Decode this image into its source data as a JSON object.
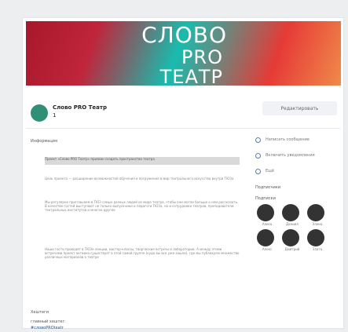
{
  "banner": {
    "line1": "СЛОВО",
    "line2": "PRO",
    "line3": "ТЕАТР"
  },
  "profile": {
    "name": "Слово PRO Театр",
    "status": "1",
    "edit_button": "Редактировать"
  },
  "info": {
    "title": "Информация",
    "description": "Проект «Слово PRO Театр» призван создать пространство театра",
    "lines": [
      "Цель проекта — расширение возможностей обучения и погружения в мир театрального искусства внутри ТЮЗа",
      "Мы регулярно приглашаем в ТЮЗ самых разных людей из мира театра, чтобы они могли больше о нем рассказать. В качестве гостей выступают не только выпускники и педагоги ТЮЗа, но и сотрудники театров, преподаватели театральных институтов и многие другие",
      "Наши гости проводят в ТЮЗе лекции, мастер-классы, творческие встречи и лаборатории. А между этими встречами проект активно существует в этой самой группе (куда вы все уже зашли), где мы публикуем множество различных материалов о театре"
    ],
    "hashtag_label": "Хештеги",
    "main_tag": "главный хештег:",
    "tag": "#словоPROteatr"
  },
  "sidebar": {
    "menu": [
      "Написать сообщение",
      "Включить уведомления",
      "Ещё"
    ],
    "stats_label": "Подписчики",
    "friends_label": "Подписки",
    "friends": [
      {
        "name": "Алиса"
      },
      {
        "name": "Даниил"
      },
      {
        "name": "Элина"
      },
      {
        "name": "Алекс"
      },
      {
        "name": "Дмитрий"
      },
      {
        "name": "Злата"
      }
    ]
  }
}
